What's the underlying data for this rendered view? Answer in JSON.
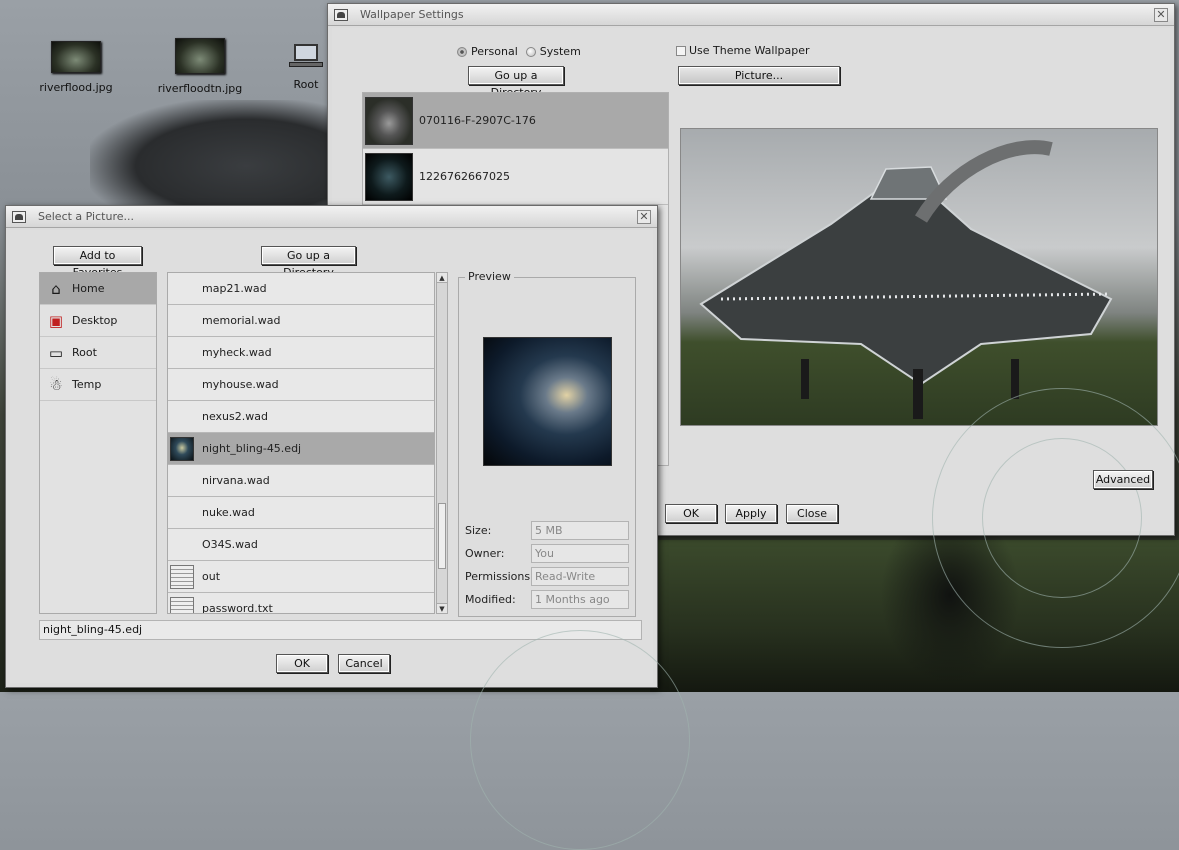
{
  "desktop": {
    "icons": [
      {
        "label": "riverflood.jpg"
      },
      {
        "label": "riverfloodtn.jpg"
      },
      {
        "label": "Root"
      }
    ]
  },
  "wallpaper_window": {
    "title": "Wallpaper Settings",
    "close_glyph": "✕",
    "radio_personal": "Personal",
    "radio_system": "System",
    "use_theme_label": "Use Theme Wallpaper",
    "go_up_label": "Go up a Directory",
    "picture_button": "Picture...",
    "items": [
      {
        "name": "070116-F-2907C-176"
      },
      {
        "name": "1226762667025"
      }
    ],
    "advanced_button": "Advanced",
    "ok_button": "OK",
    "apply_button": "Apply",
    "close_button": "Close"
  },
  "select_window": {
    "title": "Select a Picture...",
    "close_glyph": "✕",
    "add_favorites_button": "Add to Favorites",
    "go_up_button": "Go up a Directory",
    "places": [
      {
        "label": "Home",
        "icon": "home-icon"
      },
      {
        "label": "Desktop",
        "icon": "desktop-icon"
      },
      {
        "label": "Root",
        "icon": "computer-icon"
      },
      {
        "label": "Temp",
        "icon": "temp-folder-icon"
      }
    ],
    "files": [
      {
        "name": "map21.wad"
      },
      {
        "name": "memorial.wad"
      },
      {
        "name": "myheck.wad"
      },
      {
        "name": "myhouse.wad"
      },
      {
        "name": "nexus2.wad"
      },
      {
        "name": "night_bling-45.edj"
      },
      {
        "name": "nirvana.wad"
      },
      {
        "name": "nuke.wad"
      },
      {
        "name": "O34S.wad"
      },
      {
        "name": "out"
      },
      {
        "name": "password.txt"
      }
    ],
    "preview_legend": "Preview",
    "meta": {
      "size_label": "Size:",
      "size_value": "5 MB",
      "owner_label": "Owner:",
      "owner_value": "You",
      "permissions_label": "Permissions:",
      "permissions_value": "Read-Write",
      "modified_label": "Modified:",
      "modified_value": "1 Months ago"
    },
    "filename_value": "night_bling-45.edj",
    "ok_button": "OK",
    "cancel_button": "Cancel"
  }
}
